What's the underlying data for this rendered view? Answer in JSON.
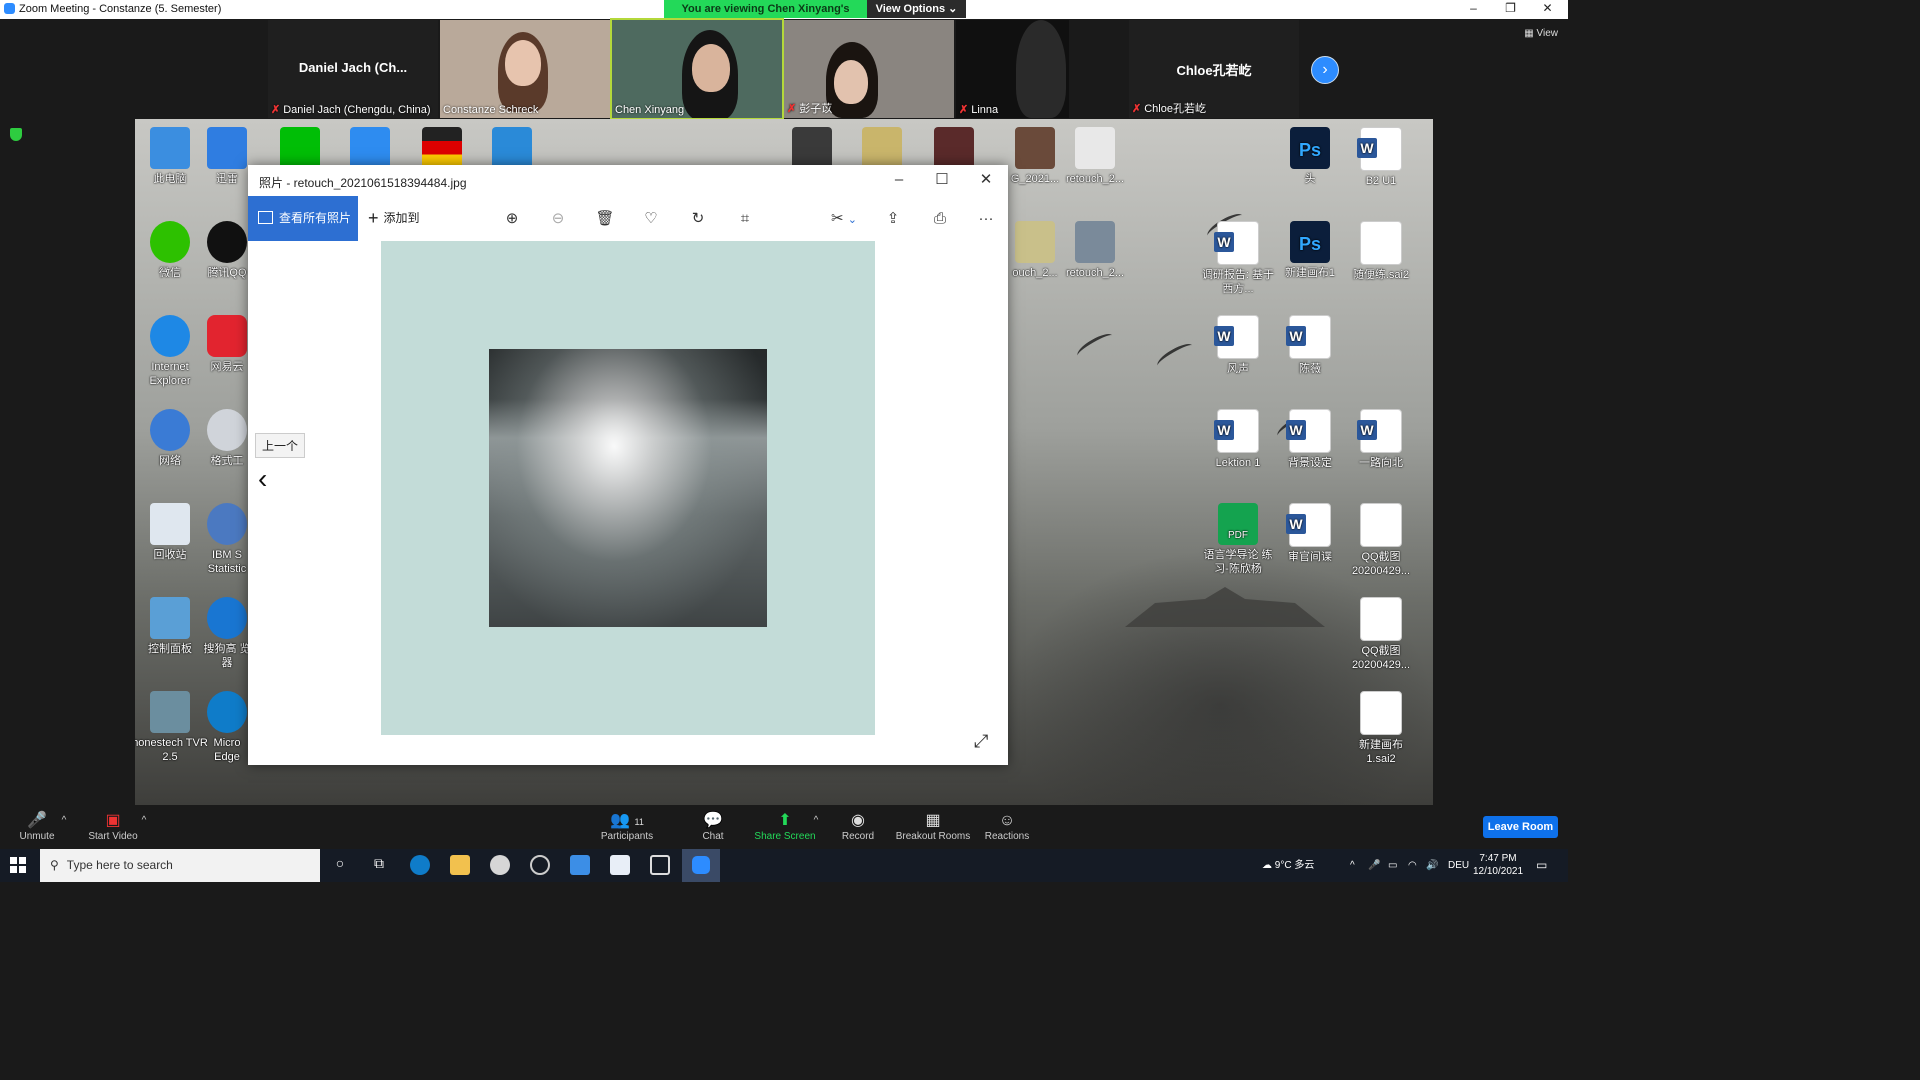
{
  "zoom": {
    "window_title": "Zoom Meeting - Constanze (5. Semester)",
    "banner": "You are viewing Chen Xinyang's screen",
    "view_options": "View Options",
    "view_button": "View",
    "next_icon": "chevron-right-icon",
    "participants_tiles": [
      {
        "name": "Daniel Jach (Chengdu, China)",
        "display": "Daniel Jach (Ch...",
        "muted": true
      },
      {
        "name": "Constanze Schreck",
        "muted": false
      },
      {
        "name": "Chen Xinyang",
        "muted": false
      },
      {
        "name": "彭子苡",
        "muted": true
      },
      {
        "name": "Linna",
        "muted": true
      },
      {
        "name": "Chloe孔若屹",
        "display": "Chloe孔若屹",
        "muted": true
      }
    ],
    "toolbar": {
      "unmute": "Unmute",
      "start_video": "Start Video",
      "participants": "Participants",
      "participants_count": "11",
      "chat": "Chat",
      "share_screen": "Share Screen",
      "record": "Record",
      "breakout_rooms": "Breakout Rooms",
      "reactions": "Reactions",
      "leave_room": "Leave Room"
    },
    "colors": {
      "accent": "#2d8cff",
      "share_green": "#23d959",
      "leave": "#0e71eb"
    }
  },
  "desktop": {
    "icons_left": [
      {
        "label": "此电脑"
      },
      {
        "label": "迅雷"
      },
      {
        "label": "微信"
      },
      {
        "label": "腾讯QQ"
      },
      {
        "label": "Internet Explorer"
      },
      {
        "label": "网易云"
      },
      {
        "label": "网络"
      },
      {
        "label": "格式工"
      },
      {
        "label": "回收站"
      },
      {
        "label": "IBM S Statistic"
      },
      {
        "label": "控制面板"
      },
      {
        "label": "搜狗高 览器"
      },
      {
        "label": "honestech TVR 2.5"
      },
      {
        "label": "Micro Edge"
      }
    ],
    "icons_right": [
      {
        "label": "G_2021..."
      },
      {
        "label": "retouch_2..."
      },
      {
        "label": "头"
      },
      {
        "label": "B2 U1"
      },
      {
        "label": "ouch_2..."
      },
      {
        "label": "retouch_2..."
      },
      {
        "label": "调研报告: 基于西方..."
      },
      {
        "label": "新建画布1"
      },
      {
        "label": "随便练.sai2"
      },
      {
        "label": "风声"
      },
      {
        "label": "陈薇"
      },
      {
        "label": "Lektion 1"
      },
      {
        "label": "背景设定"
      },
      {
        "label": "一路向北"
      },
      {
        "label": "语言学导论 练习-陈欣杨"
      },
      {
        "label": "审官间谍"
      },
      {
        "label": "QQ截图 20200429..."
      },
      {
        "label": "QQ截图 20200429..."
      },
      {
        "label": "新建画布 1.sai2"
      }
    ]
  },
  "photos": {
    "title": "照片 - retouch_2021061518394484.jpg",
    "view_all": "查看所有照片",
    "add_to": "添加到",
    "tooltip": "上一个",
    "tools": [
      "zoom-in-icon",
      "zoom-out-icon",
      "delete-icon",
      "heart-icon",
      "rotate-icon",
      "crop-icon",
      "edit-icon",
      "share-icon",
      "print-icon",
      "more-icon"
    ]
  },
  "taskbar": {
    "search_placeholder": "Type here to search",
    "weather": "9°C 多云",
    "lang": "DEU",
    "time": "7:47 PM",
    "date": "12/10/2021"
  }
}
